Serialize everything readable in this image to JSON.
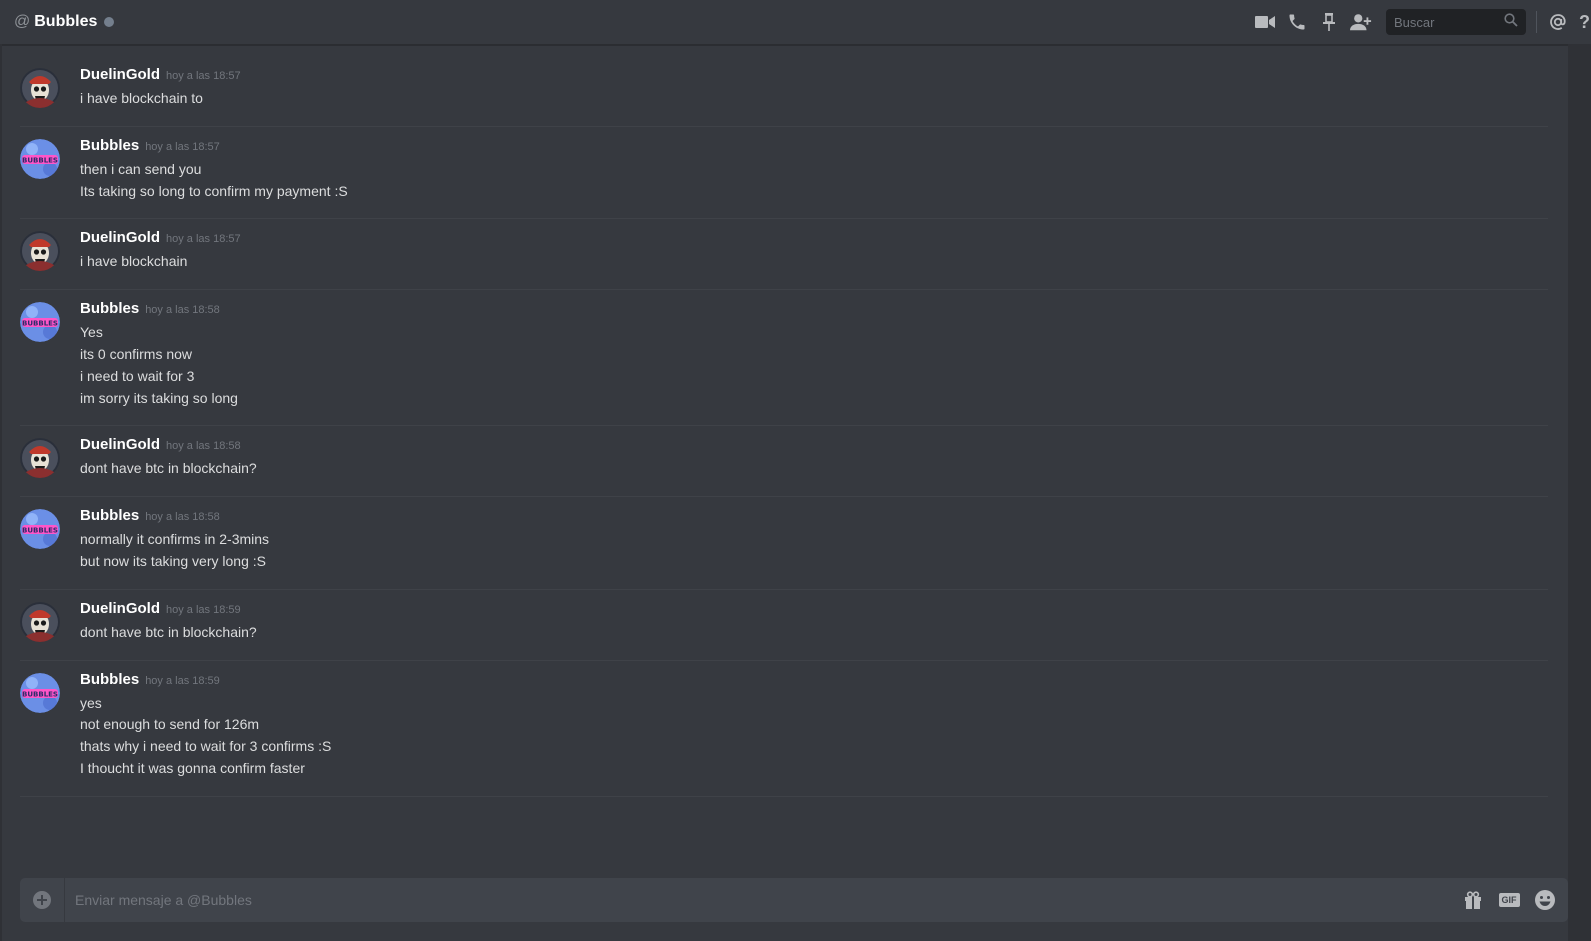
{
  "header": {
    "at_symbol": "@",
    "title": "Bubbles",
    "search_placeholder": "Buscar",
    "icons": [
      "video-call-icon",
      "voice-call-icon",
      "pin-icon",
      "add-friend-icon",
      "search-icon",
      "mention-icon",
      "help-icon"
    ],
    "help_label": "?"
  },
  "colors": {
    "background": "#36393f",
    "header_text": "#ffffff",
    "timestamp": "#72767d",
    "status_offline": "#747f8d",
    "input_bg": "#40444b"
  },
  "messages": [
    {
      "author": "DuelinGold",
      "avatar": "duelingold-avatar",
      "time": "hoy a las 18:57",
      "lines": [
        "i have blockchain to"
      ]
    },
    {
      "author": "Bubbles",
      "avatar": "bubbles-avatar",
      "time": "hoy a las 18:57",
      "lines": [
        "then i can send you",
        "Its taking so long to confirm my payment :S"
      ]
    },
    {
      "author": "DuelinGold",
      "avatar": "duelingold-avatar",
      "time": "hoy a las 18:57",
      "lines": [
        "i have blockchain"
      ]
    },
    {
      "author": "Bubbles",
      "avatar": "bubbles-avatar",
      "time": "hoy a las 18:58",
      "lines": [
        "Yes",
        "its 0 confirms now",
        "i need to wait for 3",
        "im sorry its taking so long"
      ]
    },
    {
      "author": "DuelinGold",
      "avatar": "duelingold-avatar",
      "time": "hoy a las 18:58",
      "lines": [
        "dont have btc in blockchain?"
      ]
    },
    {
      "author": "Bubbles",
      "avatar": "bubbles-avatar",
      "time": "hoy a las 18:58",
      "lines": [
        "normally it confirms in 2-3mins",
        "but now its taking very long :S"
      ]
    },
    {
      "author": "DuelinGold",
      "avatar": "duelingold-avatar",
      "time": "hoy a las 18:59",
      "lines": [
        "dont have btc in blockchain?"
      ]
    },
    {
      "author": "Bubbles",
      "avatar": "bubbles-avatar",
      "time": "hoy a las 18:59",
      "lines": [
        "yes",
        "not enough to send for 126m",
        "thats why i need to wait for 3 confirms :S",
        "I thoucht it was gonna confirm faster"
      ]
    }
  ],
  "avatar_text": {
    "bubbles": "BUBBLES"
  },
  "composer": {
    "placeholder": "Enviar mensaje a @Bubbles",
    "gif_label": "GIF",
    "icons": [
      "attach-plus-icon",
      "gift-icon",
      "gif-icon",
      "emoji-icon"
    ]
  }
}
